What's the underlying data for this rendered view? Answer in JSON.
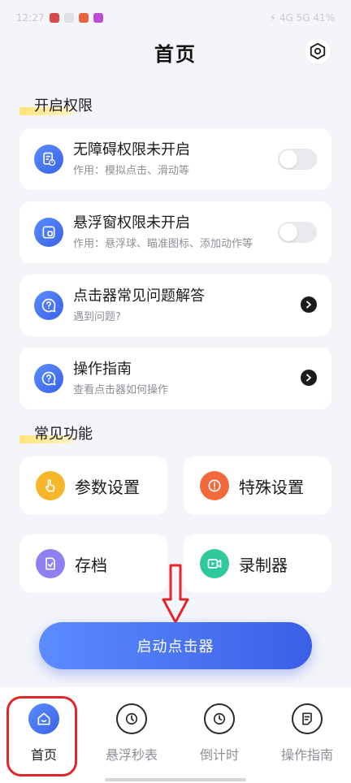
{
  "status_bar": {
    "time": "12:27",
    "right_text": "⚡ 4G 5G 41%"
  },
  "header": {
    "title": "首页",
    "settings_icon": "hexagon-gear-icon"
  },
  "section_permissions": {
    "title": "开启权限"
  },
  "cards": [
    {
      "title": "无障碍权限未开启",
      "subtitle": "作用：模拟点击、滑动等",
      "icon": "document-alert-icon",
      "control": "toggle",
      "toggle_on": false
    },
    {
      "title": "悬浮窗权限未开启",
      "subtitle": "作用：悬浮球、瞄准图标、添加动作等",
      "icon": "floating-window-icon",
      "control": "toggle",
      "toggle_on": false
    },
    {
      "title": "点击器常见问题解答",
      "subtitle": "遇到问题?",
      "icon": "question-bubble-icon",
      "control": "arrow"
    },
    {
      "title": "操作指南",
      "subtitle": "查看点击器如何操作",
      "icon": "question-bubble-icon",
      "control": "arrow"
    }
  ],
  "section_features": {
    "title": "常见功能"
  },
  "tiles": [
    {
      "label": "参数设置",
      "icon": "hand-pointer-icon",
      "color": "#f7b62a"
    },
    {
      "label": "特殊设置",
      "icon": "alert-circle-icon",
      "color": "#f26a3b"
    },
    {
      "label": "存档",
      "icon": "archive-icon",
      "color": "#8f80f2"
    },
    {
      "label": "录制器",
      "icon": "video-record-icon",
      "color": "#2fc99b"
    }
  ],
  "start_button": {
    "label": "启动点击器"
  },
  "tabbar": {
    "tabs": [
      {
        "label": "首页",
        "icon": "home-icon",
        "active": true
      },
      {
        "label": "悬浮秒表",
        "icon": "stopwatch-icon",
        "active": false
      },
      {
        "label": "倒计时",
        "icon": "clock-icon",
        "active": false
      },
      {
        "label": "操作指南",
        "icon": "guide-doc-icon",
        "active": false
      }
    ]
  },
  "colors": {
    "accent": "#3b62e6",
    "background": "#f4f5f9",
    "highlight_box": "#e1262c"
  }
}
